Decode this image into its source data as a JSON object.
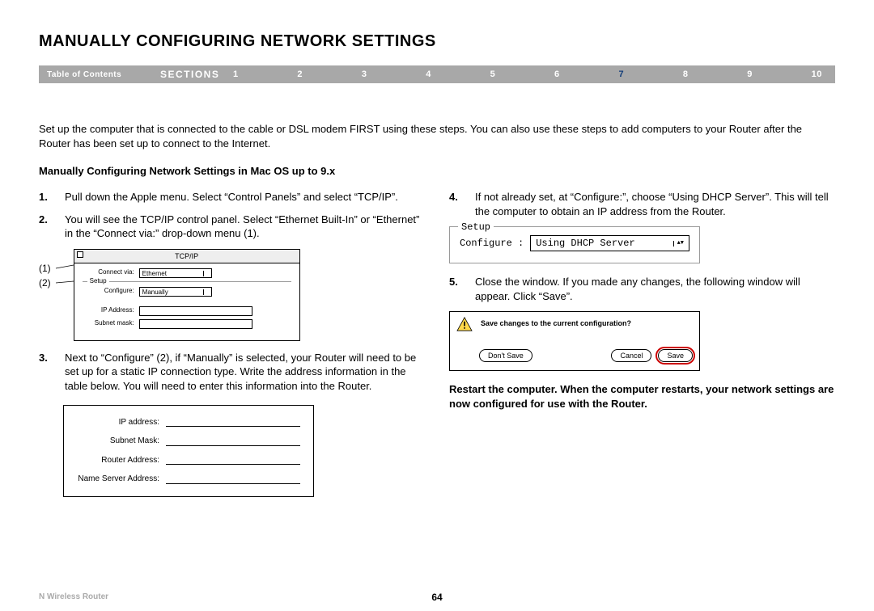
{
  "title": "MANUALLY CONFIGURING NETWORK SETTINGS",
  "nav": {
    "toc": "Table of Contents",
    "sections": "SECTIONS",
    "items": [
      "1",
      "2",
      "3",
      "4",
      "5",
      "6",
      "7",
      "8",
      "9",
      "10"
    ],
    "active_index": 6
  },
  "intro": "Set up the computer that is connected to the cable or DSL modem FIRST using these steps. You can also use these steps to add computers to your Router after the Router has been set up to connect to the Internet.",
  "subhead": "Manually Configuring Network Settings in Mac OS up to 9.x",
  "left": {
    "steps": [
      {
        "n": "1.",
        "t": "Pull down the Apple menu. Select “Control Panels” and select “TCP/IP”."
      },
      {
        "n": "2.",
        "t": "You will see the TCP/IP control panel. Select “Ethernet Built-In” or “Ethernet” in the “Connect via:” drop-down menu (1)."
      },
      {
        "n": "3.",
        "t": "Next to “Configure” (2), if “Manually” is selected, your Router will need to be set up for a static IP connection type. Write the address information in the table below. You will need to enter this information into the Router."
      }
    ],
    "callout1": "(1)",
    "callout2": "(2)",
    "tcpip": {
      "title": "TCP/IP",
      "connect_label": "Connect via:",
      "connect_value": "Ethernet",
      "setup_label": "Setup",
      "configure_label": "Configure:",
      "configure_value": "Manually",
      "ip_label": "IP Address:",
      "subnet_label": "Subnet mask:"
    },
    "addr_table": {
      "rows": [
        "IP address:",
        "Subnet Mask:",
        "Router Address:",
        "Name Server Address:"
      ]
    }
  },
  "right": {
    "steps_a": [
      {
        "n": "4.",
        "t": "If not already set, at “Configure:”, choose “Using DHCP Server”. This will tell the computer to obtain an IP address from the Router."
      }
    ],
    "setup": {
      "legend": "Setup",
      "label": "Configure :",
      "value": "Using DHCP Server"
    },
    "steps_b": [
      {
        "n": "5.",
        "t": "Close the window. If you made any changes, the following window will appear. Click “Save”."
      }
    ],
    "save_dialog": {
      "msg": "Save changes to the current configuration?",
      "dont": "Don't Save",
      "cancel": "Cancel",
      "save": "Save"
    },
    "restart": "Restart the computer. When the computer restarts, your network settings are now configured for use with the Router."
  },
  "footer": {
    "product": "N Wireless Router",
    "page": "64"
  }
}
